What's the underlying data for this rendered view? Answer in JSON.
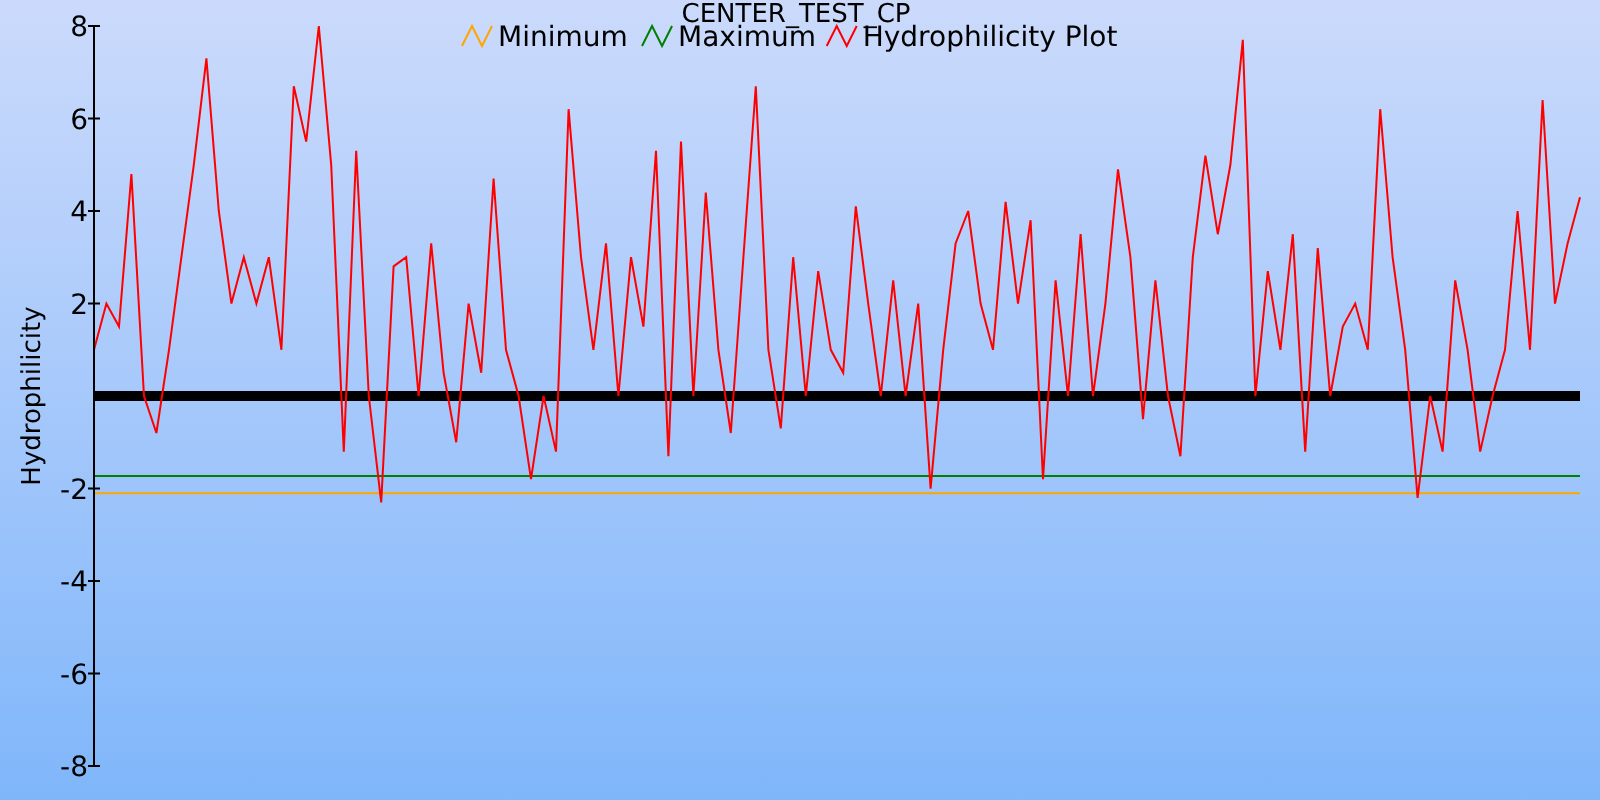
{
  "chart_data": {
    "type": "line",
    "title": "CENTER_TEST_CP",
    "ylabel": "Hydrophilicity",
    "legend": "top",
    "ylim": [
      -8,
      8
    ],
    "yticks": [
      -8,
      -6,
      -4,
      -2,
      2,
      4,
      6,
      8
    ],
    "series": [
      {
        "name": "Minimum",
        "color": "#ffa500",
        "values": [
          -2.1,
          -2.1,
          -2.1,
          -2.1,
          -2.1,
          -2.1,
          -2.1,
          -2.1,
          -2.1,
          -2.1,
          -2.1,
          -2.1,
          -2.1,
          -2.1,
          -2.1,
          -2.1,
          -2.1,
          -2.1,
          -2.1,
          -2.1,
          -2.1,
          -2.1,
          -2.1,
          -2.1,
          -2.1,
          -2.1,
          -2.1,
          -2.1,
          -2.1,
          -2.1,
          -2.1,
          -2.1,
          -2.1,
          -2.1,
          -2.1,
          -2.1,
          -2.1,
          -2.1,
          -2.1,
          -2.1,
          -2.1,
          -2.1,
          -2.1,
          -2.1,
          -2.1,
          -2.1,
          -2.1,
          -2.1,
          -2.1,
          -2.1,
          -2.1,
          -2.1,
          -2.1,
          -2.1,
          -2.1,
          -2.1,
          -2.1,
          -2.1,
          -2.1,
          -2.1,
          -2.1,
          -2.1,
          -2.1,
          -2.1,
          -2.1,
          -2.1,
          -2.1,
          -2.1,
          -2.1,
          -2.1,
          -2.1,
          -2.1,
          -2.1,
          -2.1,
          -2.1,
          -2.1,
          -2.1,
          -2.1,
          -2.1,
          -2.1,
          -2.1,
          -2.1,
          -2.1,
          -2.1,
          -2.1,
          -2.1,
          -2.1,
          -2.1,
          -2.1,
          -2.1,
          -2.1,
          -2.1,
          -2.1,
          -2.1,
          -2.1,
          -2.1,
          -2.1,
          -2.1,
          -2.1,
          -2.1,
          -2.1,
          -2.1,
          -2.1,
          -2.1,
          -2.1,
          -2.1,
          -2.1,
          -2.1,
          -2.1,
          -2.1,
          -2.1,
          -2.1,
          -2.1,
          -2.1,
          -2.1,
          -2.1,
          -2.1,
          -2.1,
          -2.1,
          -2.1
        ]
      },
      {
        "name": "Maximum",
        "color": "#008000",
        "values": [
          -1.73,
          -1.73,
          -1.73,
          -1.73,
          -1.73,
          -1.73,
          -1.73,
          -1.73,
          -1.73,
          -1.73,
          -1.73,
          -1.73,
          -1.73,
          -1.73,
          -1.73,
          -1.73,
          -1.73,
          -1.73,
          -1.73,
          -1.73,
          -1.73,
          -1.73,
          -1.73,
          -1.73,
          -1.73,
          -1.73,
          -1.73,
          -1.73,
          -1.73,
          -1.73,
          -1.73,
          -1.73,
          -1.73,
          -1.73,
          -1.73,
          -1.73,
          -1.73,
          -1.73,
          -1.73,
          -1.73,
          -1.73,
          -1.73,
          -1.73,
          -1.73,
          -1.73,
          -1.73,
          -1.73,
          -1.73,
          -1.73,
          -1.73,
          -1.73,
          -1.73,
          -1.73,
          -1.73,
          -1.73,
          -1.73,
          -1.73,
          -1.73,
          -1.73,
          -1.73,
          -1.73,
          -1.73,
          -1.73,
          -1.73,
          -1.73,
          -1.73,
          -1.73,
          -1.73,
          -1.73,
          -1.73,
          -1.73,
          -1.73,
          -1.73,
          -1.73,
          -1.73,
          -1.73,
          -1.73,
          -1.73,
          -1.73,
          -1.73,
          -1.73,
          -1.73,
          -1.73,
          -1.73,
          -1.73,
          -1.73,
          -1.73,
          -1.73,
          -1.73,
          -1.73,
          -1.73,
          -1.73,
          -1.73,
          -1.73,
          -1.73,
          -1.73,
          -1.73,
          -1.73,
          -1.73,
          -1.73,
          -1.73,
          -1.73,
          -1.73,
          -1.73,
          -1.73,
          -1.73,
          -1.73,
          -1.73,
          -1.73,
          -1.73,
          -1.73,
          -1.73,
          -1.73,
          -1.73,
          -1.73,
          -1.73,
          -1.73,
          -1.73,
          -1.73,
          -1.73
        ]
      },
      {
        "name": "Hydrophilicity Plot",
        "color": "#ff0000",
        "values": [
          1,
          2,
          1.5,
          4.8,
          0,
          -0.8,
          1,
          3,
          5,
          7.3,
          4,
          2,
          3,
          2,
          3,
          1,
          6.7,
          5.5,
          8,
          5,
          -1.2,
          5.3,
          0,
          -2.3,
          2.8,
          3,
          0,
          3.3,
          0.5,
          -1,
          2,
          0.5,
          4.7,
          1,
          0,
          -1.8,
          0,
          -1.2,
          6.2,
          3,
          1,
          3.3,
          0,
          3,
          1.5,
          5.3,
          -1.3,
          5.5,
          0,
          4.4,
          1,
          -0.8,
          3,
          6.7,
          1,
          -0.7,
          3,
          0,
          2.7,
          1,
          0.5,
          4.1,
          2,
          0,
          2.5,
          0,
          2,
          -2,
          1,
          3.3,
          4,
          2,
          1,
          4.2,
          2,
          3.8,
          -1.8,
          2.5,
          0,
          3.5,
          0,
          2,
          4.9,
          3,
          -0.5,
          2.5,
          0,
          -1.3,
          3,
          5.2,
          3.5,
          5,
          7.7,
          0,
          2.7,
          1,
          3.5,
          -1.2,
          3.2,
          0,
          1.5,
          2,
          1,
          6.2,
          3,
          1,
          -2.2,
          0,
          -1.2,
          2.5,
          1,
          -1.2,
          0,
          1,
          4,
          1,
          6.4,
          2,
          3.3,
          4.3
        ]
      }
    ]
  }
}
